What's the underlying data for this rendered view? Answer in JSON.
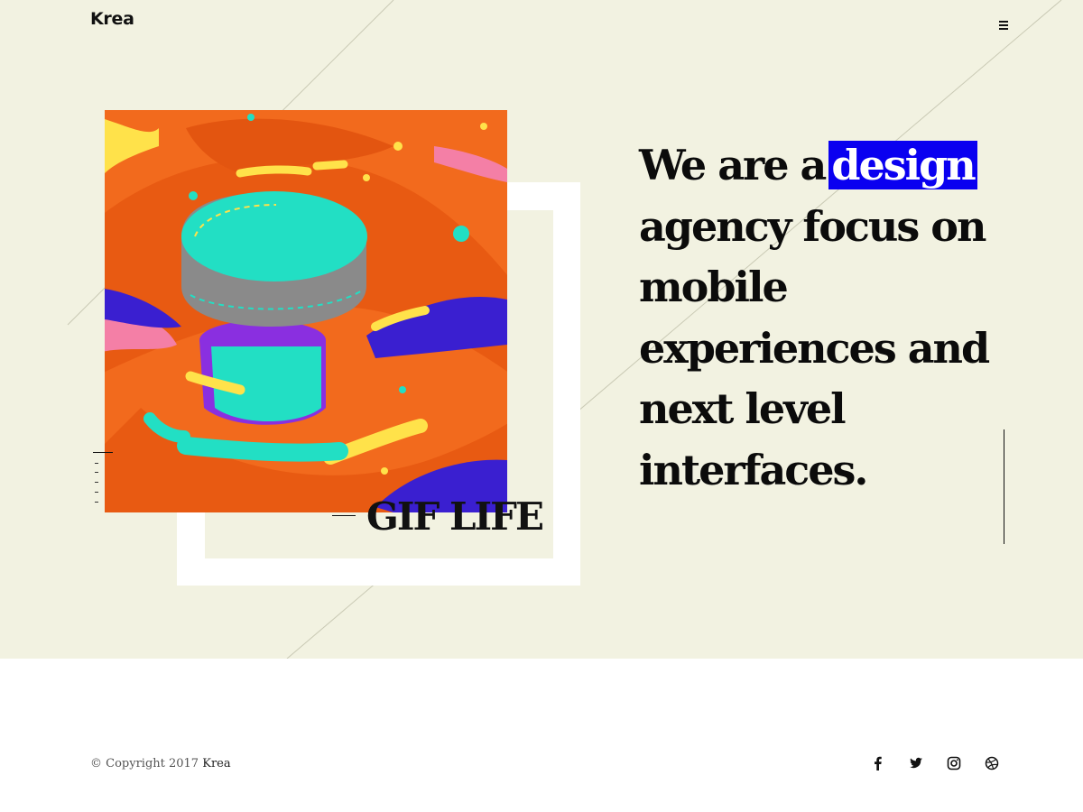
{
  "header": {
    "logo": "Krea",
    "menu_icon": "hamburger-menu-icon"
  },
  "hero": {
    "headline_before": "We are a",
    "headline_highlight": "design",
    "headline_after": "agency focus on mobile experiences and next level interfaces.",
    "caption": "GIF LIFE",
    "image_alt": "abstract animated illustration"
  },
  "colors": {
    "hero_bg": "#f2f2e1",
    "highlight": "#0a00f0",
    "art_orange": "#f26a1d",
    "art_teal": "#22dfc4",
    "art_purple": "#3a1fd0"
  },
  "footer": {
    "copyright": "© Copyright 2017",
    "brand": "Krea",
    "social": [
      "facebook-icon",
      "twitter-icon",
      "instagram-icon",
      "dribbble-icon"
    ]
  }
}
